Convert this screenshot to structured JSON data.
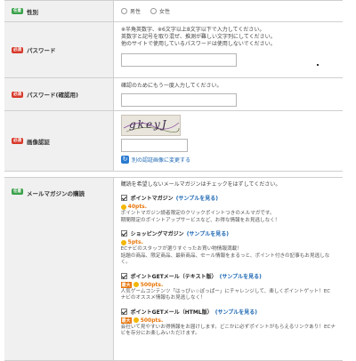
{
  "badges": {
    "required": "必須",
    "optional": "任意"
  },
  "gender": {
    "label": "性別",
    "options": [
      "男性",
      "女性"
    ]
  },
  "password": {
    "label": "パスワード",
    "notes": [
      "※半角英数字、※6文字以上8文字以下で入力してください。",
      "英数字と記号を取り混ぜ、推測が難しい文字列にしてください。",
      "他のサイトで使用しているパスワードは使用しないでください。"
    ],
    "value": ""
  },
  "password_confirm": {
    "label": "パスワード(確認用)",
    "note": "確認のためにもう一度入力してください。",
    "value": ""
  },
  "captcha": {
    "label": "画像認証",
    "image_text": "gkeyJ",
    "value": "",
    "refresh_label": "別の認証画像に変更する"
  },
  "mailmag": {
    "label": "メールマガジンの購読",
    "note": "購読を希望しないメールマガジンはチェックをはずしてください。",
    "sample_label": "(サンプルを見る)",
    "items": [
      {
        "title": "ポイントマガジン",
        "max": "",
        "points": "40pts.",
        "desc": [
          "ポイントマガジン読者限定のクリックポイントつきのメルマガです。",
          "期間限定のポイントアップサービスなど、お得な情報をお見逃しなく！"
        ]
      },
      {
        "title": "ショッピングマガジン",
        "max": "",
        "points": "5pts.",
        "desc": [
          "ECナビのスタッフが選りすぐったお買い物情報満載！",
          "話題の商品、限定商品、最新商品、セール情報をまるっと、ポイント付きの記事もお見逃しな",
          "く。"
        ]
      },
      {
        "title": "ポイントGETメール（テキスト版）",
        "max": "最大",
        "points": "500pts.",
        "desc": [
          "人気ゲームコンテンツ「はっぴぃ☆ぽっぱー」にチャレンジして、楽しくポイントゲット！EC",
          "ナビのオススメ情報もお見逃しなく！"
        ]
      },
      {
        "title": "ポイントGETメール（HTML版）",
        "max": "最大",
        "points": "500pts.",
        "desc": [
          "会社いて見やすいお得情報をお届けします。どこかに必ずポイントがもらえるリンクあり！ECナ",
          "ビを存分にお楽しみいただけます。"
        ]
      }
    ]
  }
}
